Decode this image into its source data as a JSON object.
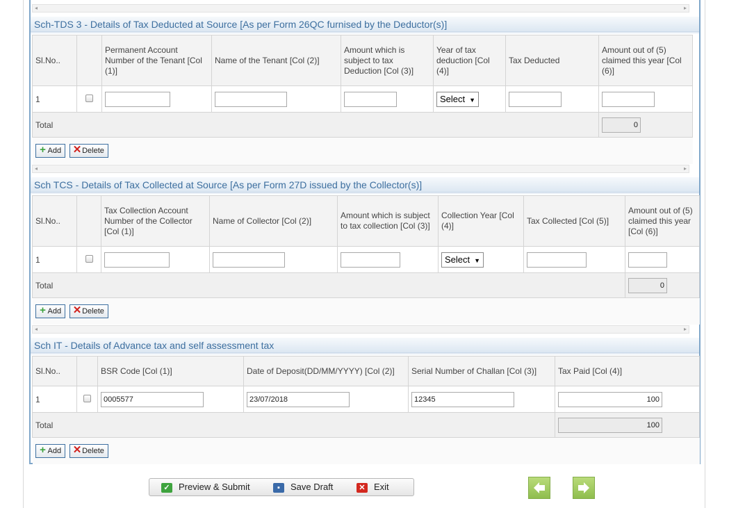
{
  "sch_tds3": {
    "title": "Sch-TDS 3 - Details of Tax Deducted at Source [As per Form 26QC furnised by the Deductor(s)]",
    "headers": [
      "Sl.No..",
      "Permanent Account Number of the Tenant [Col (1)]",
      "Name of the Tenant [Col (2)]",
      "Amount which is subject to tax Deduction [Col (3)]",
      "Year of tax deduction [Col (4)]",
      "Tax Deducted",
      "Amount out of (5) claimed this year [Col (6)]"
    ],
    "row": {
      "sl": "1",
      "year_select": "Select"
    },
    "total_label": "Total",
    "total_value": "0"
  },
  "sch_tcs": {
    "title": "Sch TCS - Details of Tax Collected at Source [As per Form 27D issued by the Collector(s)]",
    "headers": [
      "Sl.No..",
      "Tax Collection Account Number of the Collector [Col (1)]",
      "Name of Collector [Col (2)]",
      "Amount which is subject to tax collection [Col (3)]",
      "Collection Year [Col (4)]",
      "Tax Collected [Col (5)]",
      "Amount out of (5) claimed this year [Col (6)]"
    ],
    "row": {
      "sl": "1",
      "year_select": "Select"
    },
    "total_label": "Total",
    "total_value": "0"
  },
  "sch_it": {
    "title": "Sch IT - Details of Advance tax and self assessment tax",
    "headers": [
      "Sl.No..",
      "BSR Code [Col (1)]",
      "Date of Deposit(DD/MM/YYYY) [Col (2)]",
      "Serial Number of Challan [Col (3)]",
      "Tax Paid [Col (4)]"
    ],
    "row": {
      "sl": "1",
      "bsr_code": "0005577",
      "date_of_deposit": "23/07/2018",
      "challan_serial": "12345",
      "tax_paid": "100"
    },
    "total_label": "Total",
    "total_value": "100"
  },
  "buttons": {
    "add": "Add",
    "delete": "Delete"
  },
  "footer": {
    "preview_submit": "Preview & Submit",
    "save_draft": "Save Draft",
    "exit": "Exit"
  },
  "colors": {
    "section_title": "#3d6f9f",
    "frame_border": "#7fa6c9",
    "nav_green": "#8fbe4e"
  },
  "icons": {
    "add": "plus-icon",
    "delete": "delete-x-icon",
    "preview": "check-icon",
    "save": "floppy-icon",
    "exit": "exit-x-icon",
    "prev": "arrow-left-icon",
    "next": "arrow-right-icon"
  }
}
